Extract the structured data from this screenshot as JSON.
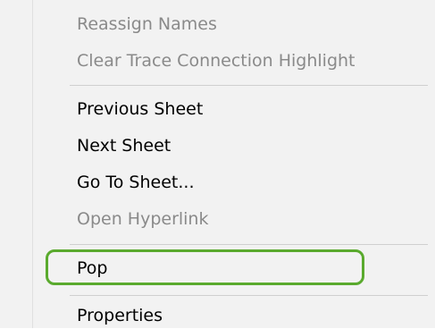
{
  "context_menu": {
    "items": [
      {
        "label": "Reassign Names",
        "enabled": false
      },
      {
        "label": "Clear Trace Connection Highlight",
        "enabled": false
      },
      {
        "label": "Previous Sheet",
        "enabled": true
      },
      {
        "label": "Next Sheet",
        "enabled": true
      },
      {
        "label": "Go To Sheet...",
        "enabled": true
      },
      {
        "label": "Open Hyperlink",
        "enabled": false
      },
      {
        "label": "Pop",
        "enabled": true,
        "highlighted": true
      },
      {
        "label": "Properties",
        "enabled": true
      }
    ]
  },
  "colors": {
    "menu_background": "#f2f2f2",
    "text_enabled": "#000000",
    "text_disabled": "#8a8a8a",
    "separator": "#d0d0d0",
    "highlight_outline": "#5aaa2e"
  }
}
